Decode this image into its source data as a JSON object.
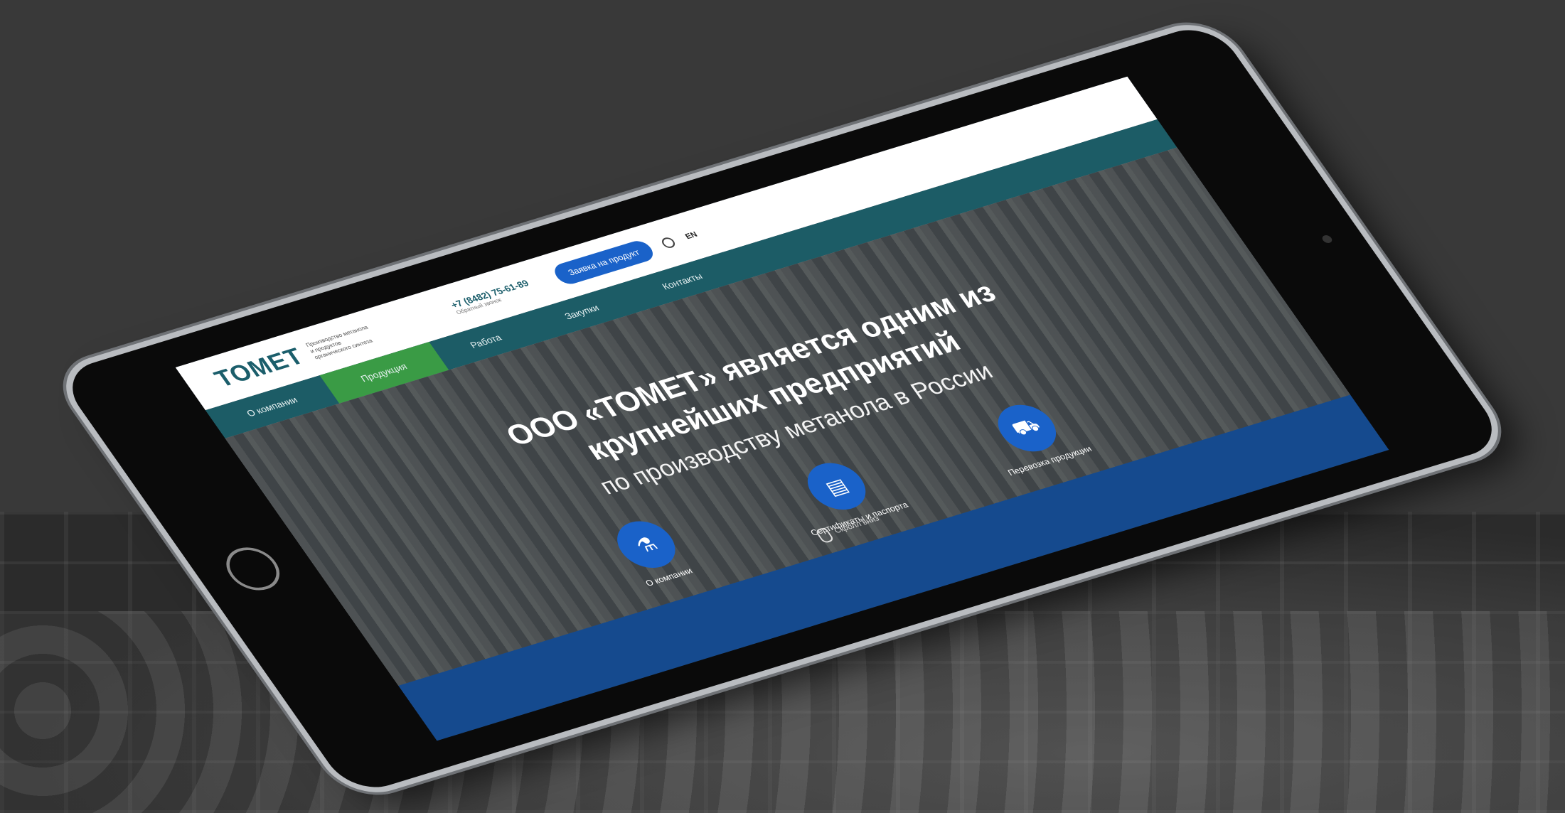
{
  "header": {
    "logo": "ТОМЕТ",
    "tagline": "Производство метанола и продуктов органического синтеза",
    "phone": "+7 (8482) 75-61-89",
    "phone_sub": "Обратный звонок",
    "order_label": "Заявка на продукт",
    "lang": "EN"
  },
  "nav": {
    "items": [
      {
        "label": "О компании"
      },
      {
        "label": "Продукция",
        "active": true
      },
      {
        "label": "Работа"
      },
      {
        "label": "Закупки"
      },
      {
        "label": "Контакты"
      }
    ]
  },
  "hero": {
    "title": "ООО «ТОМЕТ» является одним из крупнейших предприятий",
    "subtitle": "по производству метанола в России",
    "cards": [
      {
        "label": "О компании",
        "icon": "flask-icon"
      },
      {
        "label": "Сертификаты и паспорта",
        "icon": "document-icon"
      },
      {
        "label": "Перевозка продукции",
        "icon": "truck-icon"
      }
    ],
    "scroll_hint": "Скролл вниз"
  },
  "colors": {
    "brand": "#1b5e6b",
    "nav_bg": "#1c5c66",
    "active_nav": "#3a9b45",
    "accent_blue": "#1a62c9",
    "footer_band": "#154a8e"
  }
}
